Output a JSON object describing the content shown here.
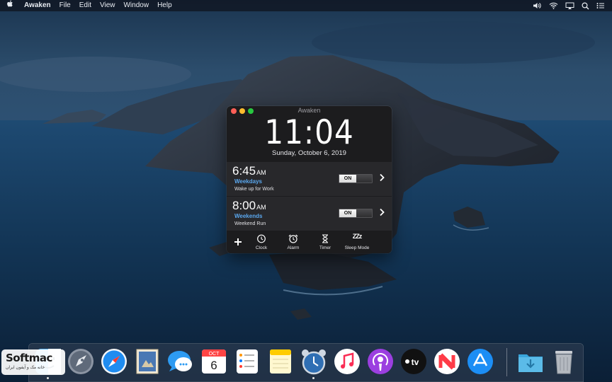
{
  "menubar": {
    "apple_icon": "apple-logo",
    "app_name": "Awaken",
    "menus": [
      "File",
      "Edit",
      "View",
      "Window",
      "Help"
    ],
    "status_icons": [
      "volume-icon",
      "wifi-icon",
      "airplay-icon",
      "search-icon",
      "list-icon"
    ]
  },
  "window": {
    "title": "Awaken",
    "clock": {
      "time": "11:04",
      "date": "Sunday, October 6, 2019"
    },
    "alarms": [
      {
        "time": "6:45",
        "ampm": "AM",
        "label": "Weekdays",
        "description": "Wake up for Work",
        "toggle": "ON"
      },
      {
        "time": "8:00",
        "ampm": "AM",
        "label": "Weekends",
        "description": "Weekend Run",
        "toggle": "ON"
      }
    ],
    "toolbar": {
      "add": "+",
      "clock": "Clock",
      "alarm": "Alarm",
      "timer": "Timer",
      "sleep": "Sleep Mode",
      "sleep_glyph": "ZZz"
    }
  },
  "dock": {
    "apps": [
      "Finder",
      "Launchpad",
      "Safari",
      "Mail",
      "Messages",
      "Calendar",
      "Reminders",
      "Notes",
      "Awaken",
      "Music",
      "Podcasts",
      "TV",
      "News",
      "App Store",
      "Downloads",
      "Trash"
    ],
    "calendar": {
      "month": "OCT",
      "day": "6"
    },
    "tv_label": "tv"
  },
  "watermark": {
    "brand": "Softmac",
    "subtitle": "خانه مک و آیفون ایران"
  },
  "colors": {
    "accent_blue": "#5aa7ee",
    "window_bg": "#1c1c1e",
    "row_bg": "#28282b"
  }
}
